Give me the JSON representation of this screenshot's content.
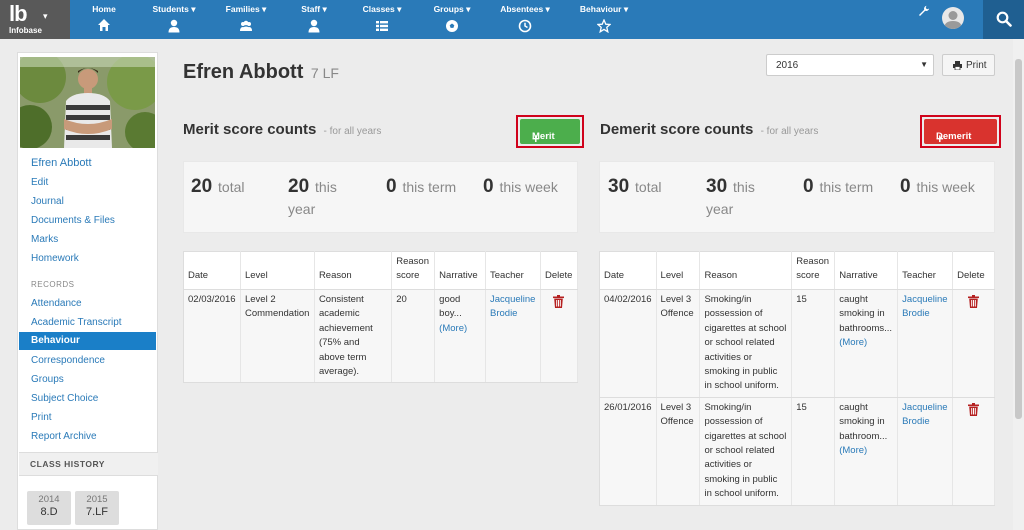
{
  "app": {
    "logo_text": "lb",
    "logo_subtitle": "Infobase",
    "nav": [
      {
        "label": "Home",
        "icon": "home-icon"
      },
      {
        "label": "Students ▾",
        "icon": "user-icon"
      },
      {
        "label": "Families ▾",
        "icon": "group-icon"
      },
      {
        "label": "Staff ▾",
        "icon": "user-icon"
      },
      {
        "label": "Classes ▾",
        "icon": "list-icon"
      },
      {
        "label": "Groups ▾",
        "icon": "soccer-ball-icon"
      },
      {
        "label": "Absentees ▾",
        "icon": "clock-icon"
      },
      {
        "label": "Behaviour ▾",
        "icon": "star-icon"
      }
    ],
    "colors": {
      "nav": "#2a7ab8",
      "merit": "#4cae4c",
      "demerit": "#d9332e",
      "highlight": "#d0021b"
    }
  },
  "sidebar": {
    "name": "Efren Abbott",
    "links": [
      "Edit",
      "Journal",
      "Documents & Files",
      "Marks",
      "Homework"
    ],
    "records_heading": "RECORDS",
    "records": [
      "Attendance",
      "Academic Transcript",
      "Behaviour",
      "Correspondence",
      "Groups",
      "Subject Choice",
      "Print",
      "Report Archive"
    ],
    "active_record": "Behaviour",
    "class_history_heading": "CLASS HISTORY",
    "class_history": [
      {
        "year": "2014",
        "class": "8.D"
      },
      {
        "year": "2015",
        "class": "7.LF"
      }
    ]
  },
  "header": {
    "student_name": "Efren Abbott",
    "student_class": "7 LF",
    "year_value": "2016",
    "print_label": "Print"
  },
  "merit": {
    "title": "Merit score counts",
    "subtitle": "- for all years",
    "button_label": "Merit",
    "stats": {
      "total": {
        "value": "20",
        "label": "total"
      },
      "year": {
        "value": "20",
        "label1": "this",
        "label2": "year"
      },
      "term": {
        "value": "0",
        "label": "this term"
      },
      "week": {
        "value": "0",
        "label": "this week"
      }
    },
    "columns": [
      "Date",
      "Level",
      "Reason",
      "Reason score",
      "Narrative",
      "Teacher",
      "Delete"
    ],
    "rows": [
      {
        "date": "02/03/2016",
        "level": "Level 2 Commendation",
        "reason": "Consistent academic achievement (75% and above term average).",
        "score": "20",
        "narrative": "good boy...",
        "more": "(More)",
        "teacher": "Jacqueline Brodie"
      }
    ]
  },
  "demerit": {
    "title": "Demerit score counts",
    "subtitle": "- for all years",
    "button_label": "Demerit",
    "stats": {
      "total": {
        "value": "30",
        "label": "total"
      },
      "year": {
        "value": "30",
        "label1": "this",
        "label2": "year"
      },
      "term": {
        "value": "0",
        "label": "this term"
      },
      "week": {
        "value": "0",
        "label": "this week"
      }
    },
    "columns": [
      "Date",
      "Level",
      "Reason",
      "Reason score",
      "Narrative",
      "Teacher",
      "Delete"
    ],
    "rows": [
      {
        "date": "04/02/2016",
        "level": "Level 3 Offence",
        "reason": "Smoking/in possession of cigarettes at school or school related activities or smoking in public in school uniform.",
        "score": "15",
        "narrative": "caught smoking in bathrooms...",
        "more": "(More)",
        "teacher": "Jacqueline Brodie"
      },
      {
        "date": "26/01/2016",
        "level": "Level 3 Offence",
        "reason": "Smoking/in possession of cigarettes at school or school related activities or smoking in public in school uniform.",
        "score": "15",
        "narrative": "caught smoking in bathroom...",
        "more": "(More)",
        "teacher": "Jacqueline Brodie"
      }
    ]
  }
}
